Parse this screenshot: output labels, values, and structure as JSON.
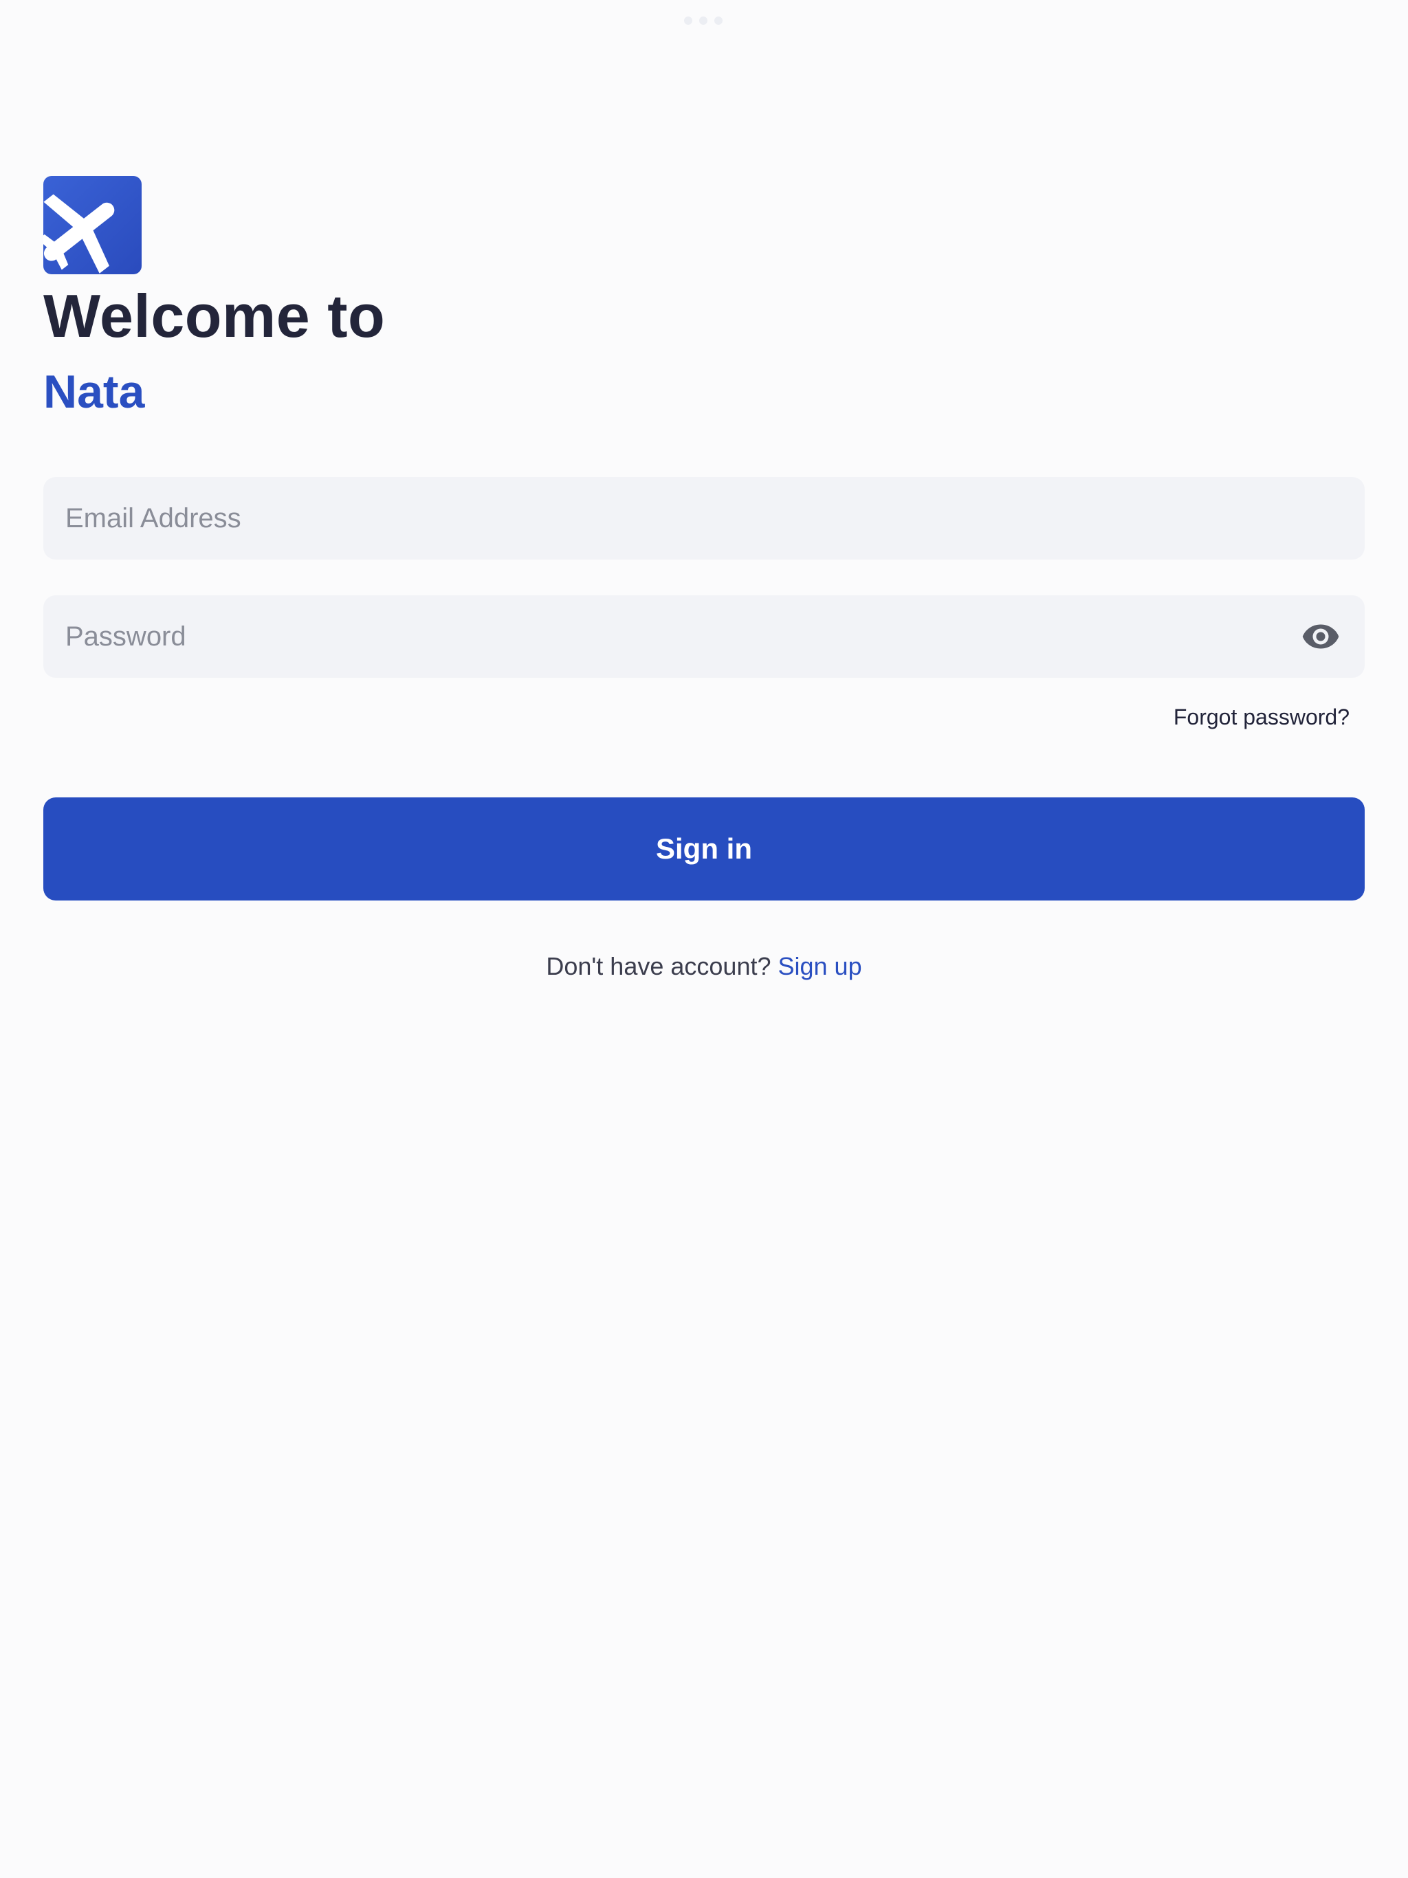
{
  "header": {
    "welcome_text": "Welcome to",
    "brand_name": "Nata"
  },
  "login_form": {
    "email_placeholder": "Email Address",
    "email_value": "",
    "password_placeholder": "Password",
    "password_value": "",
    "forgot_password_label": "Forgot password?",
    "sign_in_label": "Sign in"
  },
  "footer": {
    "no_account_text": "Don't have account?",
    "sign_up_label": "Sign up"
  },
  "icons": {
    "logo": "airplane-icon",
    "password_toggle": "eye-icon"
  },
  "colors": {
    "brand_blue": "#274dc0",
    "heading_dark": "#23253a",
    "field_background": "#f2f3f7",
    "page_background": "#fbfbfc"
  }
}
